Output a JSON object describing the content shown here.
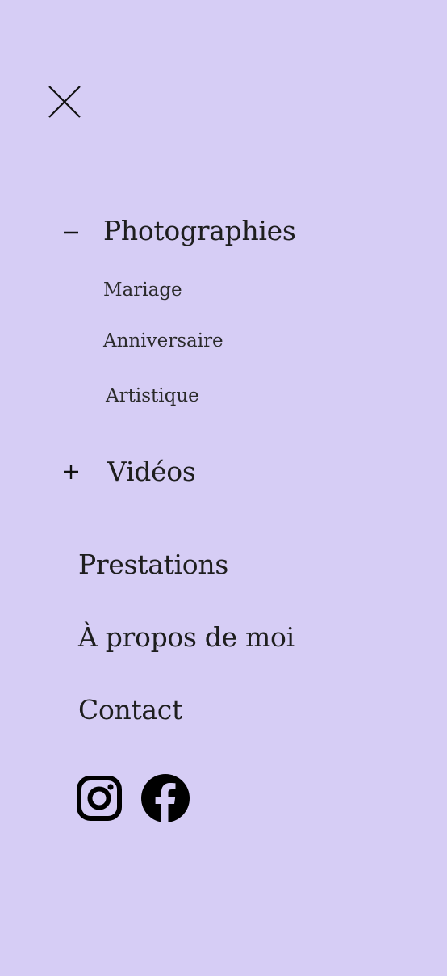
{
  "menu": {
    "sections": [
      {
        "label": "Photographies",
        "expanded": true,
        "toggle_icon": "minus-icon",
        "items": [
          {
            "label": "Mariage"
          },
          {
            "label": "Anniversaire"
          },
          {
            "label": "Artistique"
          }
        ]
      },
      {
        "label": "Vidéos",
        "expanded": false,
        "toggle_icon": "plus-icon",
        "items": []
      }
    ],
    "links": [
      {
        "label": "Prestations"
      },
      {
        "label": "À propos de moi"
      },
      {
        "label": "Contact"
      }
    ]
  },
  "controls": {
    "close_icon": "close-icon"
  },
  "social": {
    "icons": [
      "instagram-icon",
      "facebook-icon"
    ]
  },
  "colors": {
    "background": "#d6cdf5",
    "text": "#1e1e1e"
  }
}
